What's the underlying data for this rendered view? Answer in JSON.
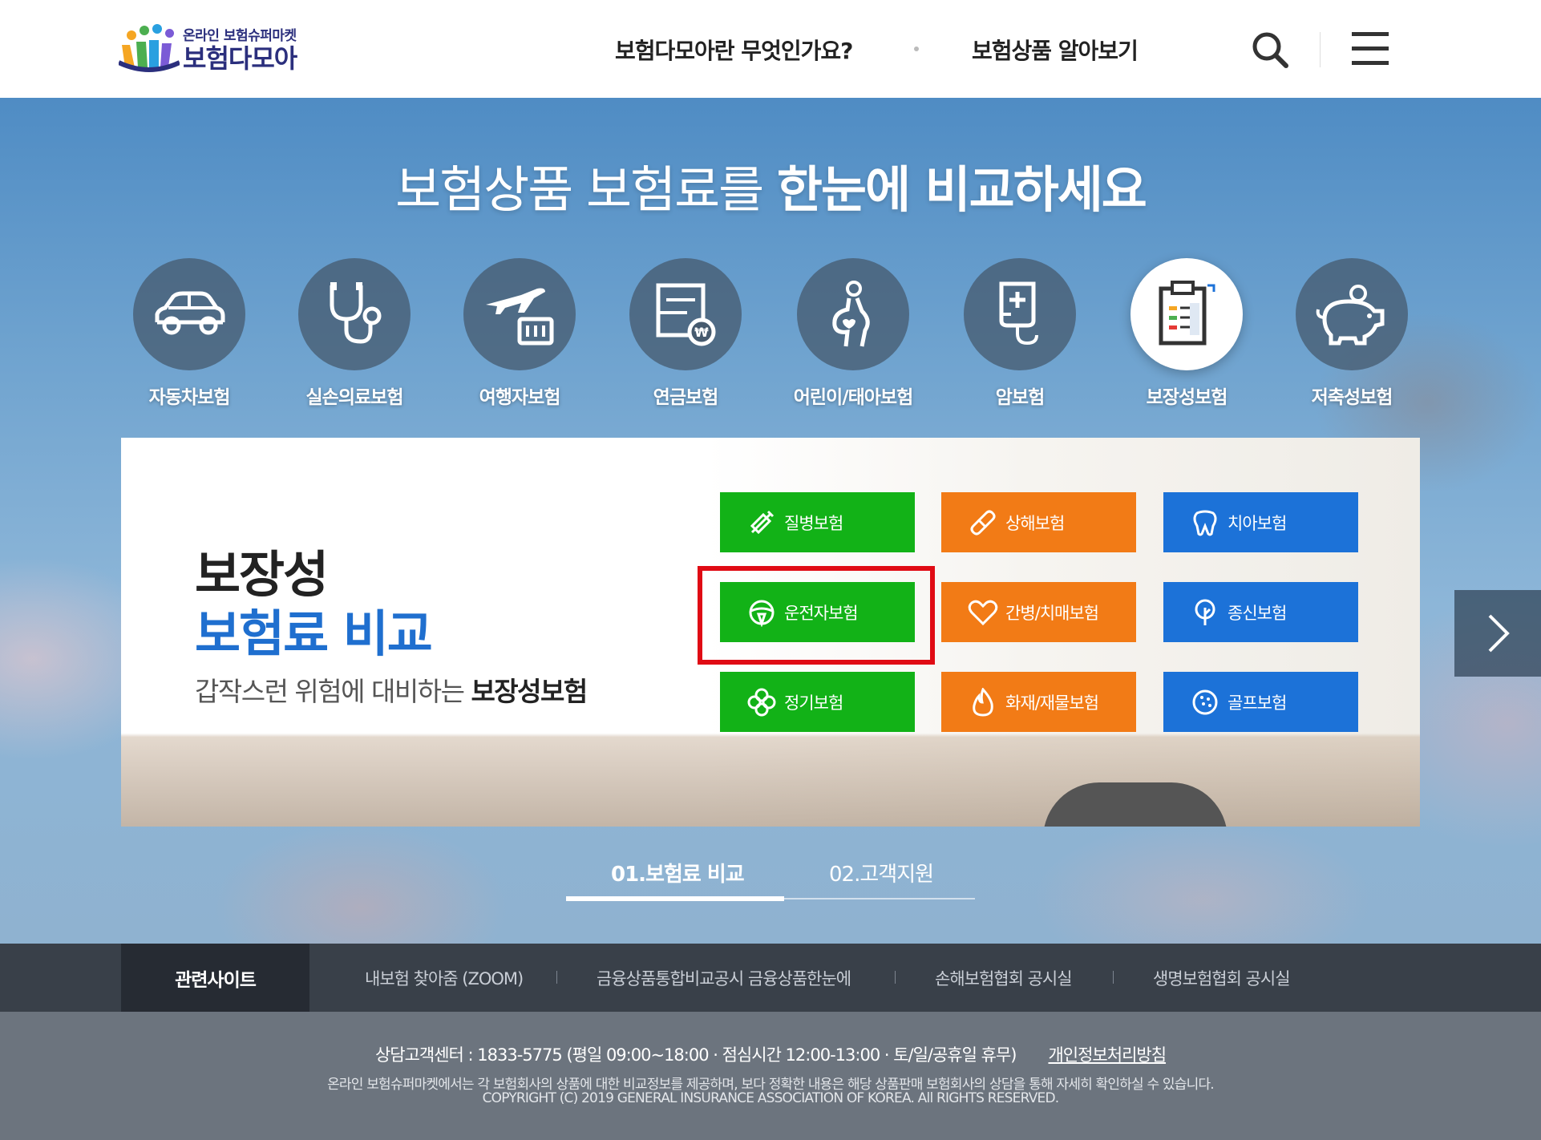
{
  "header": {
    "logo_sub": "온라인 보험슈퍼마켓",
    "logo_main": "보험다모아",
    "nav": [
      "보험다모아란 무엇인가요?",
      "보험상품 알아보기"
    ]
  },
  "hero": {
    "title_light": "보험상품 보험료를 ",
    "title_bold": "한눈에 비교하세요"
  },
  "categories": [
    {
      "label": "자동차보험",
      "icon": "car-icon"
    },
    {
      "label": "실손의료보험",
      "icon": "stethoscope-icon"
    },
    {
      "label": "여행자보험",
      "icon": "airplane-luggage-icon"
    },
    {
      "label": "연금보험",
      "icon": "pension-document-icon"
    },
    {
      "label": "어린이/태아보험",
      "icon": "pregnant-icon"
    },
    {
      "label": "암보험",
      "icon": "iv-bag-icon"
    },
    {
      "label": "보장성보험",
      "icon": "clipboard-icon",
      "active": true
    },
    {
      "label": "저축성보험",
      "icon": "piggy-bank-icon"
    }
  ],
  "panel": {
    "heading_line1": "보장성",
    "heading_line2": "보험료 비교",
    "subtitle_prefix": "갑작스런 위험에 대비하는 ",
    "subtitle_bold": "보장성보험",
    "buttons": [
      {
        "label": "질병보험",
        "color": "#12b217",
        "icon": "syringe-icon"
      },
      {
        "label": "상해보험",
        "color": "#f27b16",
        "icon": "bandage-icon"
      },
      {
        "label": "치아보험",
        "color": "#1c72d8",
        "icon": "tooth-icon"
      },
      {
        "label": "운전자보험",
        "color": "#12b217",
        "icon": "steering-wheel-icon"
      },
      {
        "label": "간병/치매보험",
        "color": "#f27b16",
        "icon": "heart-icon"
      },
      {
        "label": "종신보험",
        "color": "#1c72d8",
        "icon": "tree-icon"
      },
      {
        "label": "정기보험",
        "color": "#12b217",
        "icon": "clover-icon"
      },
      {
        "label": "화재/재물보험",
        "color": "#f27b16",
        "icon": "fire-icon"
      },
      {
        "label": "골프보험",
        "color": "#1c72d8",
        "icon": "golf-ball-icon"
      }
    ]
  },
  "tabs": [
    "01.보험료 비교",
    "02.고객지원"
  ],
  "related": {
    "label": "관련사이트",
    "links": [
      "내보험 찾아줌 (ZOOM)",
      "금융상품통합비교공시 금융상품한눈에",
      "손해보험협회 공시실",
      "생명보험협회 공시실"
    ]
  },
  "footer": {
    "contact": "상담고객센터 : 1833-5775 (평일 09:00~18:00  ·  점심시간 12:00-13:00  ·  토/일/공휴일 휴무)",
    "privacy": "개인정보처리방침",
    "notice": "온라인 보험슈퍼마켓에서는 각 보험회사의 상품에 대한 비교정보를 제공하며, 보다 정확한 내용은 해당 상품판매 보험회사의 상담을 통해 자세히 확인하실 수 있습니다.",
    "copyright": "COPYRIGHT (C) 2019 GENERAL INSURANCE ASSOCIATION OF KOREA. All RIGHTS RESERVED."
  }
}
